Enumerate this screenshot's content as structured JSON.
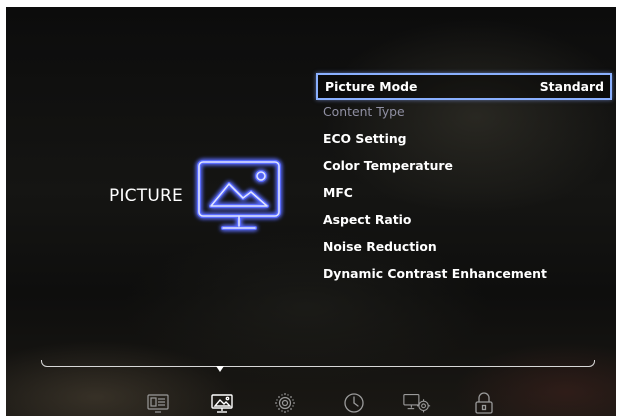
{
  "category": {
    "label": "PICTURE",
    "icon": "picture-icon"
  },
  "menu": {
    "items": [
      {
        "label": "Picture Mode",
        "value": "Standard",
        "state": "selected"
      },
      {
        "label": "Content Type",
        "state": "disabled"
      },
      {
        "label": "ECO Setting",
        "state": "normal"
      },
      {
        "label": "Color Temperature",
        "state": "normal"
      },
      {
        "label": "MFC",
        "state": "normal"
      },
      {
        "label": "Aspect Ratio",
        "state": "normal"
      },
      {
        "label": "Noise Reduction",
        "state": "normal"
      },
      {
        "label": "Dynamic Contrast Enhancement",
        "state": "normal"
      }
    ]
  },
  "tabs": [
    {
      "icon": "input-source-icon"
    },
    {
      "icon": "picture-tab-icon",
      "active": true
    },
    {
      "icon": "sound-icon"
    },
    {
      "icon": "clock-icon"
    },
    {
      "icon": "settings-icon"
    },
    {
      "icon": "lock-icon"
    }
  ],
  "colors": {
    "accent": "#8ab0ff",
    "highlight_glow": "#5a6cff",
    "text": "#ffffff",
    "disabled_text": "#8f8fa2"
  }
}
